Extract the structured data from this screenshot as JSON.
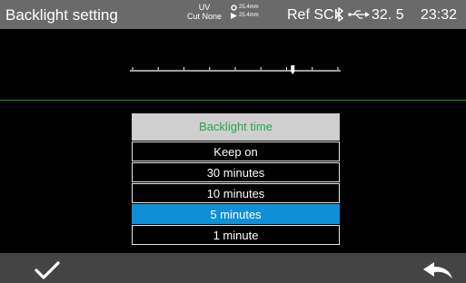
{
  "header": {
    "title": "Backlight setting",
    "uv": "UV",
    "cut": "Cut None",
    "left_length": "25.4mm",
    "right_length": "25.4mm",
    "ref": "Ref SCI",
    "voltage": "32. 5",
    "time": "23:32",
    "icons": [
      "fiber-end-icon",
      "arrow-icon",
      "bluetooth-icon",
      "usb-icon"
    ]
  },
  "slider": {
    "tick_count": 9,
    "level_fraction": 0.78
  },
  "dialog": {
    "title": "Backlight time",
    "options": [
      "Keep on",
      "30 minutes",
      "10 minutes",
      "5 minutes",
      "1 minute"
    ],
    "selected": "5 minutes"
  },
  "footer": {
    "confirm_icon": "check-icon",
    "back_icon": "back-arrow-icon"
  },
  "colors": {
    "topbar": "#6a6a6a",
    "dialog_header": "#cfcfcf",
    "dialog_title": "#27a84a",
    "selected": "#0f8fd6",
    "divider": "#2f8f2f",
    "bottombar": "#444444"
  }
}
